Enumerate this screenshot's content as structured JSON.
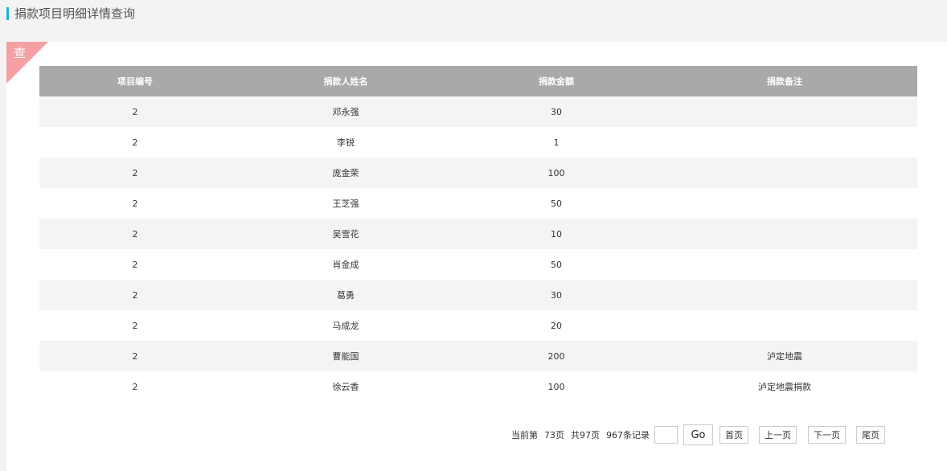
{
  "header": {
    "title": "捐款项目明细详情查询"
  },
  "corner_tag": {
    "label": "查"
  },
  "table": {
    "columns": [
      "项目编号",
      "捐款人姓名",
      "捐款金额",
      "捐款备注"
    ],
    "rows": [
      [
        "2",
        "邓永强",
        "30",
        ""
      ],
      [
        "2",
        "李锐",
        "1",
        ""
      ],
      [
        "2",
        "庞金荣",
        "100",
        ""
      ],
      [
        "2",
        "王芝强",
        "50",
        ""
      ],
      [
        "2",
        "吴雪花",
        "10",
        ""
      ],
      [
        "2",
        "肖金成",
        "50",
        ""
      ],
      [
        "2",
        "葛勇",
        "30",
        ""
      ],
      [
        "2",
        "马成龙",
        "20",
        ""
      ],
      [
        "2",
        "曹能国",
        "200",
        "泸定地震"
      ],
      [
        "2",
        "徐云香",
        "100",
        "泸定地震捐款"
      ]
    ]
  },
  "pager": {
    "current_page_label": "当前第",
    "current_page": "73页",
    "total_pages": "共97页",
    "total_records": "967条记录",
    "page_input_value": "",
    "go_label": "Go",
    "first_label": "首页",
    "prev_label": "上一页",
    "next_label": "下一页",
    "last_label": "尾页"
  },
  "colors": {
    "accent": "#1fb5d4",
    "corner_tag": "#f5a0a3",
    "table_header": "#a9a9a9",
    "row_striped": "#f4f4f4"
  }
}
